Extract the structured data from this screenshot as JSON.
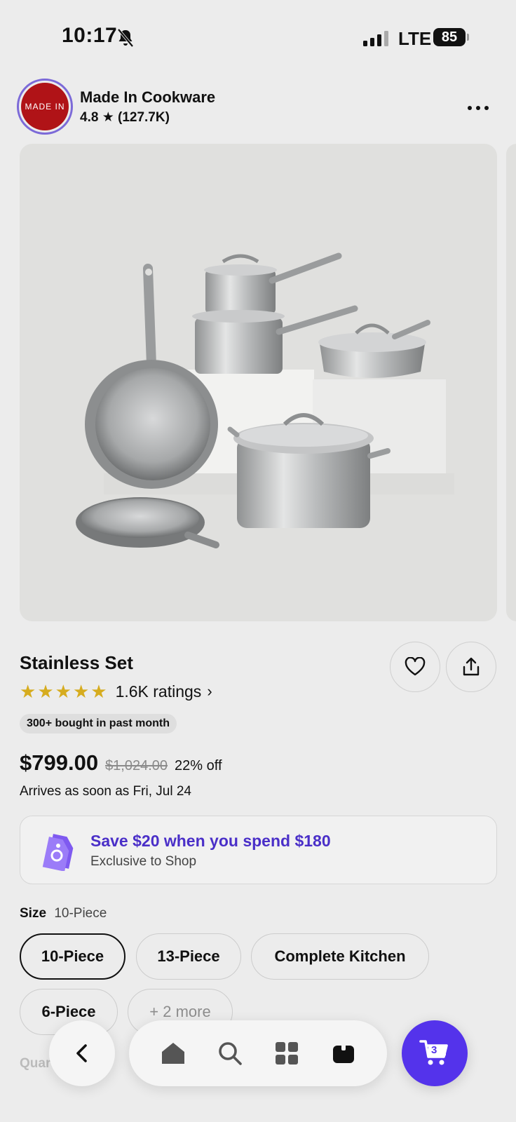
{
  "status_bar": {
    "time": "10:17",
    "network": "LTE",
    "battery": "85"
  },
  "store": {
    "logo_text": "MADE IN",
    "name": "Made In Cookware",
    "rating": "4.8 ★ (127.7K)"
  },
  "product": {
    "image_icon": "cookware-set-image",
    "title": "Stainless Set",
    "stars": 5,
    "ratings_text": "1.6K ratings",
    "bought_badge": "300+ bought in past month",
    "price": "$799.00",
    "original_price": "$1,024.00",
    "discount": "22% off",
    "arrival": "Arrives as soon as Fri, Jul 24"
  },
  "promo": {
    "title": "Save $20 when you spend $180",
    "subtitle": "Exclusive to Shop",
    "accent_color": "#4a2fc8"
  },
  "size": {
    "label": "Size",
    "selected": "10-Piece",
    "options": [
      "10-Piece",
      "13-Piece",
      "Complete Kitchen",
      "6-Piece"
    ],
    "more": "+ 2 more"
  },
  "quantity": {
    "label": "Quar"
  },
  "nav": {
    "items": [
      "back-icon",
      "home-icon",
      "search-icon",
      "grid-icon",
      "orders-icon"
    ],
    "cart_count": "3",
    "cart_color": "#5433eb"
  }
}
